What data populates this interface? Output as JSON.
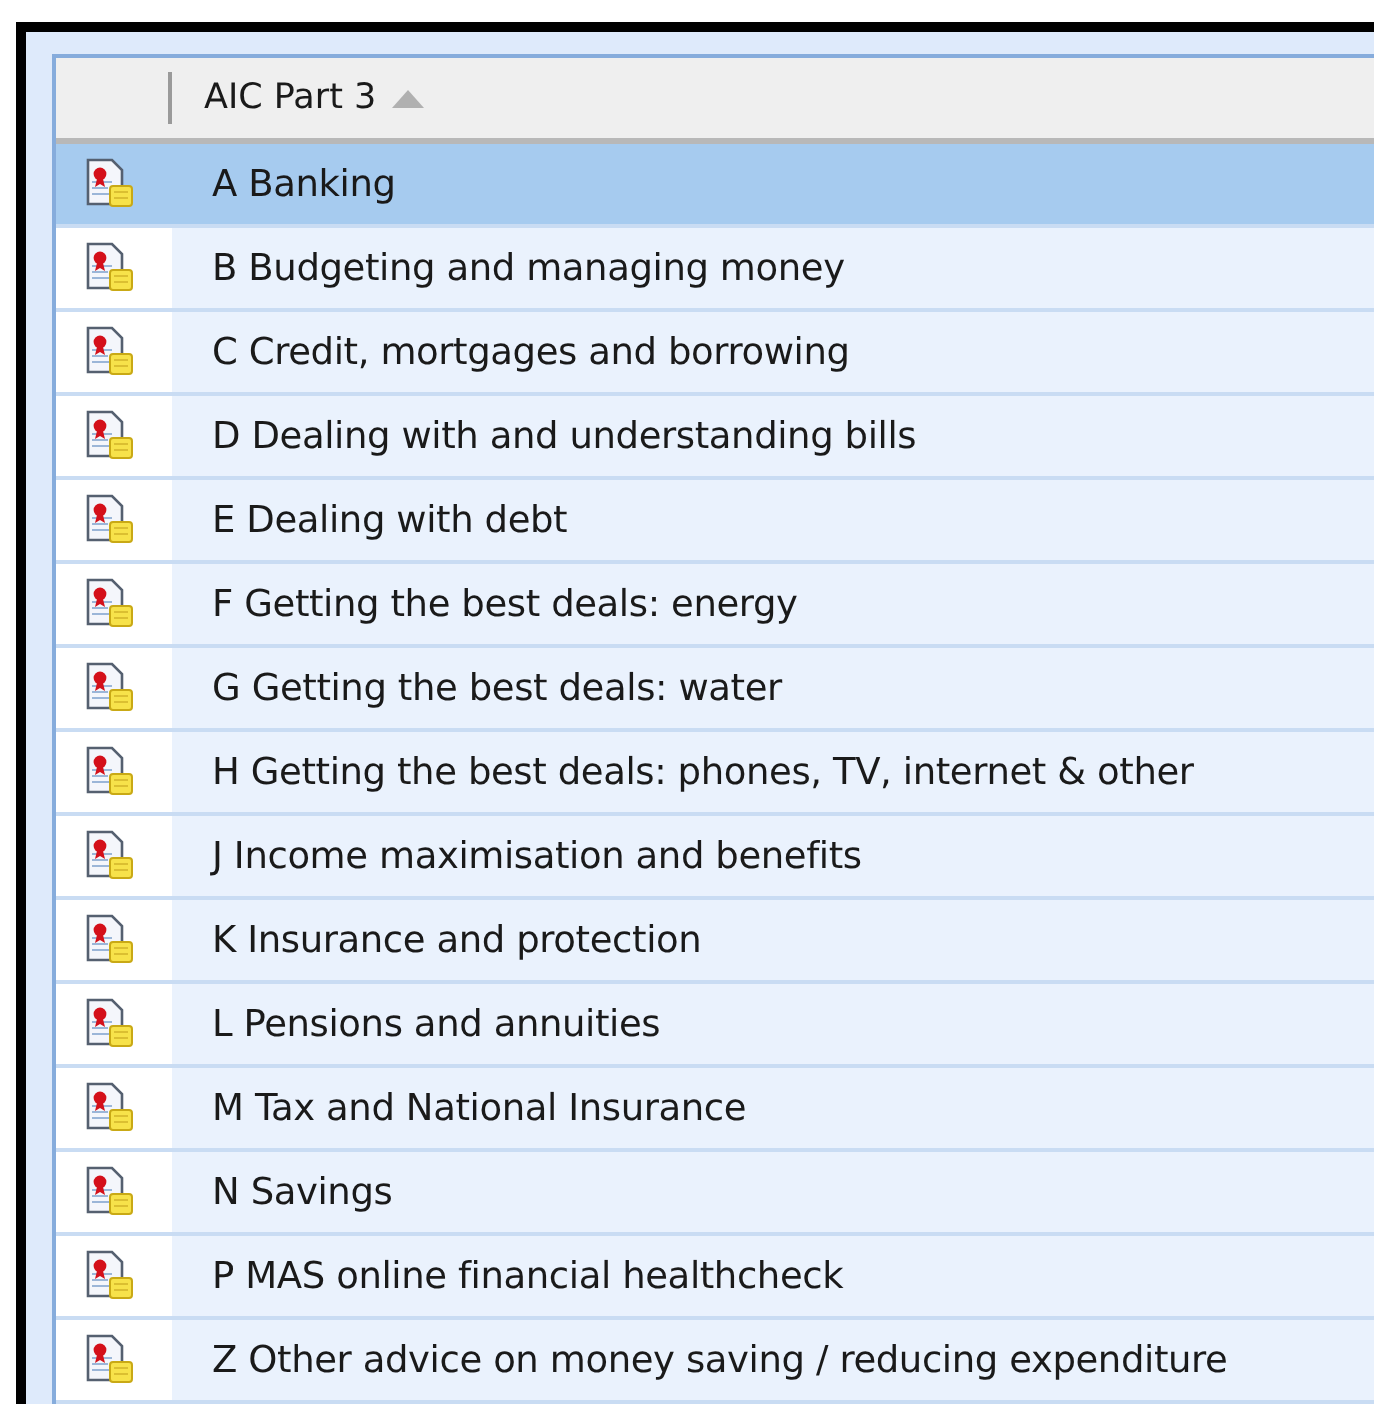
{
  "table": {
    "column": {
      "label": "AIC Part 3",
      "sorted_ascending": true
    },
    "rows": [
      {
        "label": "A Banking",
        "selected": true
      },
      {
        "label": "B Budgeting and managing money",
        "selected": false
      },
      {
        "label": "C Credit, mortgages and borrowing",
        "selected": false
      },
      {
        "label": "D Dealing with and understanding bills",
        "selected": false
      },
      {
        "label": "E Dealing with debt",
        "selected": false
      },
      {
        "label": "F Getting the best deals: energy",
        "selected": false
      },
      {
        "label": "G Getting the best deals: water",
        "selected": false
      },
      {
        "label": "H Getting the best deals: phones, TV, internet & other",
        "selected": false
      },
      {
        "label": "J Income maximisation and benefits",
        "selected": false
      },
      {
        "label": "K Insurance and protection",
        "selected": false
      },
      {
        "label": "L Pensions and annuities",
        "selected": false
      },
      {
        "label": "M Tax and National Insurance",
        "selected": false
      },
      {
        "label": "N Savings",
        "selected": false
      },
      {
        "label": "P MAS online financial healthcheck",
        "selected": false
      },
      {
        "label": "Z Other advice on money saving / reducing expenditure",
        "selected": false
      }
    ]
  }
}
